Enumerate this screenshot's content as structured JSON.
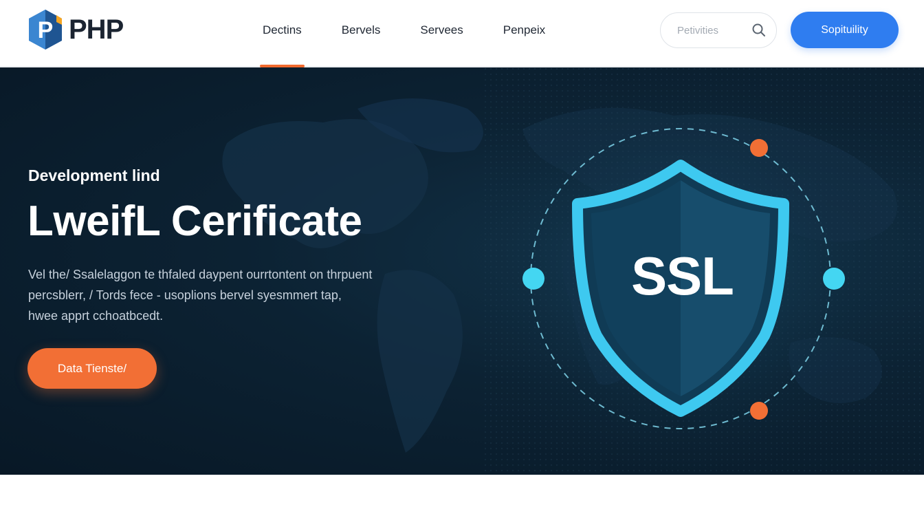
{
  "header": {
    "logo_text": "PHP",
    "nav": [
      {
        "label": "Dectins",
        "active": true
      },
      {
        "label": "Bervels",
        "active": false
      },
      {
        "label": "Servees",
        "active": false
      },
      {
        "label": "Penpeix",
        "active": false
      }
    ],
    "search_placeholder": "Petivities",
    "cta_label": "Sopituility"
  },
  "hero": {
    "eyebrow": "Development lind",
    "title": "LweifL Cerificate",
    "description": [
      "Vel the/ Ssalelaggon te thfaled daypent ourrtontent on thrpuent",
      "percsblerr, / Tords fece - usoplions bervel syesmmert tap,",
      "hwee apprt cchoatbcedt."
    ],
    "cta_label": "Data Tienste/",
    "badge_text": "SSL"
  },
  "colors": {
    "accent_orange": "#f26f35",
    "brand_blue": "#2f7df0",
    "hero_dark": "#0c2233",
    "shield_cyan": "#3ec9f0",
    "dot_cyan": "#44d6f2"
  },
  "icons": {
    "logo": "php-hex-logo",
    "search": "search-icon",
    "badge": "shield-icon"
  }
}
